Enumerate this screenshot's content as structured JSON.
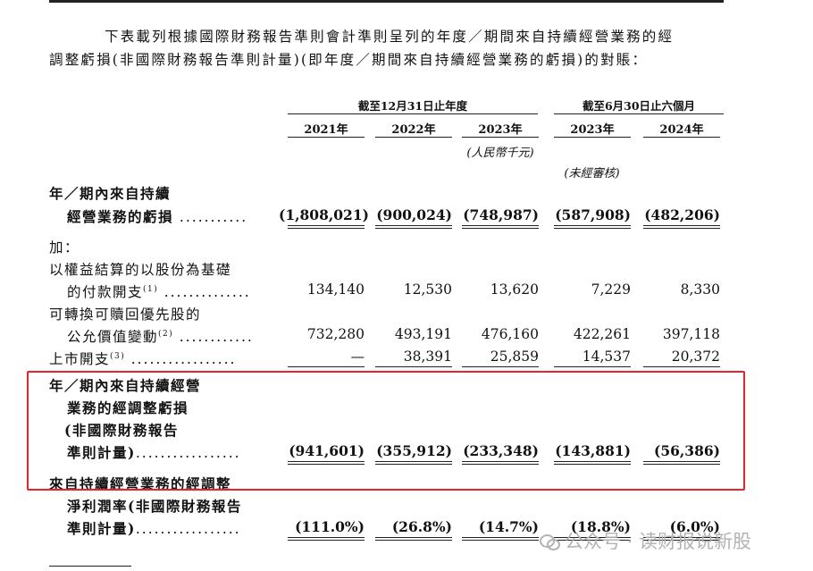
{
  "intro": {
    "line1": "下表載列根據國際財務報告準則會計準則呈列的年度／期間來自持續經營業務的經",
    "line2": "調整虧損(非國際財務報告準則計量)(即年度／期間來自持續經營業務的虧損)的對賬："
  },
  "header": {
    "group_annual": "截至12月31日止年度",
    "group_interim": "截至6月30日止六個月",
    "years": [
      "2021年",
      "2022年",
      "2023年",
      "2023年",
      "2024年"
    ],
    "unit": "(人民幣千元)",
    "unaudited": "(未經審核)"
  },
  "rows": {
    "loss": {
      "label1": "年／期內來自持續",
      "label2": "經營業務的虧損",
      "dots": "...........",
      "values": [
        "(1,808,021)",
        "(900,024)",
        "(748,987)",
        "(587,908)",
        "(482,206)"
      ]
    },
    "add_label": "加：",
    "share_comp": {
      "label1": "以權益結算的以股份為基礎",
      "label2": "的付款開支",
      "sup": "(1)",
      "dots": "..............",
      "values": [
        "134,140",
        "12,530",
        "13,620",
        "7,229",
        "8,330"
      ]
    },
    "fair_value": {
      "label1": "可轉換可贖回優先股的",
      "label2": "公允價值變動",
      "sup": "(2)",
      "dots": "............",
      "values": [
        "732,280",
        "493,191",
        "476,160",
        "422,261",
        "397,118"
      ]
    },
    "listing": {
      "label": "上市開支",
      "sup": "(3)",
      "dots": ".................",
      "values": [
        "—",
        "38,391",
        "25,859",
        "14,537",
        "20,372"
      ]
    },
    "adjusted_loss": {
      "label1": "年／期內來自持續經營",
      "label2": "業務的經調整虧損",
      "label3": "(非國際財務報告",
      "label4": "準則計量)",
      "dots": ".................",
      "values": [
        "(941,601)",
        "(355,912)",
        "(233,348)",
        "(143,881)",
        "(56,386)"
      ]
    },
    "net_margin": {
      "label1": "來自持續經營業務的經調整",
      "label2": "淨利潤率(非國際財務報告",
      "label3": "準則計量)",
      "dots": ".................",
      "values": [
        "(111.0%)",
        "(26.8%)",
        "(14.7%)",
        "(18.8%)",
        "(6.0%)"
      ]
    }
  },
  "watermark": {
    "text": "公众号 · 读财报说新股",
    "icon": "wechat-icon"
  },
  "colors": {
    "highlight": "#e8232c",
    "text": "#111111"
  }
}
